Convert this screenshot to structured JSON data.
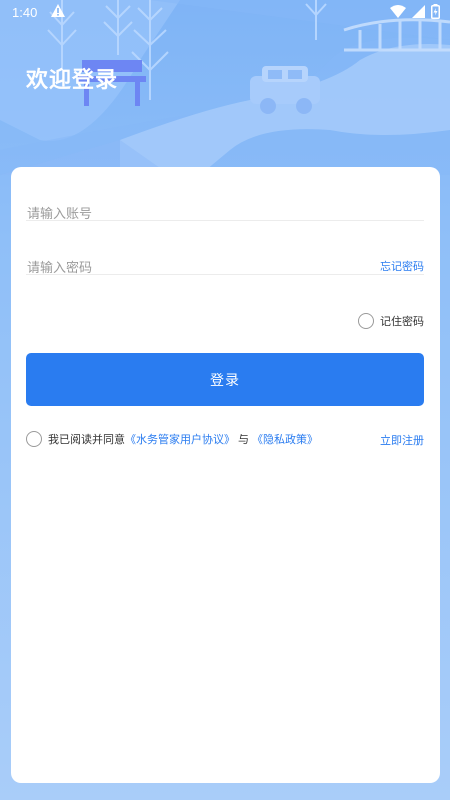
{
  "status_bar": {
    "time": "1:40",
    "icons": [
      "warning-icon",
      "wifi-icon",
      "signal-icon",
      "battery-icon"
    ]
  },
  "header": {
    "title": "欢迎登录"
  },
  "form": {
    "account_placeholder": "请输入账号",
    "password_placeholder": "请输入密码",
    "forgot_label": "忘记密码",
    "remember_label": "记住密码",
    "remember_checked": false,
    "login_label": "登录"
  },
  "agreement": {
    "checked": false,
    "prefix": "我已阅读并同意",
    "user_agreement": "《水务管家用户协议》",
    "joiner": "与",
    "privacy_policy": "《隐私政策》",
    "register_label": "立即注册"
  },
  "colors": {
    "accent": "#2a7cf0",
    "background_top": "#7fb4f6",
    "background_bottom": "#a9cdf9",
    "card": "#ffffff"
  }
}
